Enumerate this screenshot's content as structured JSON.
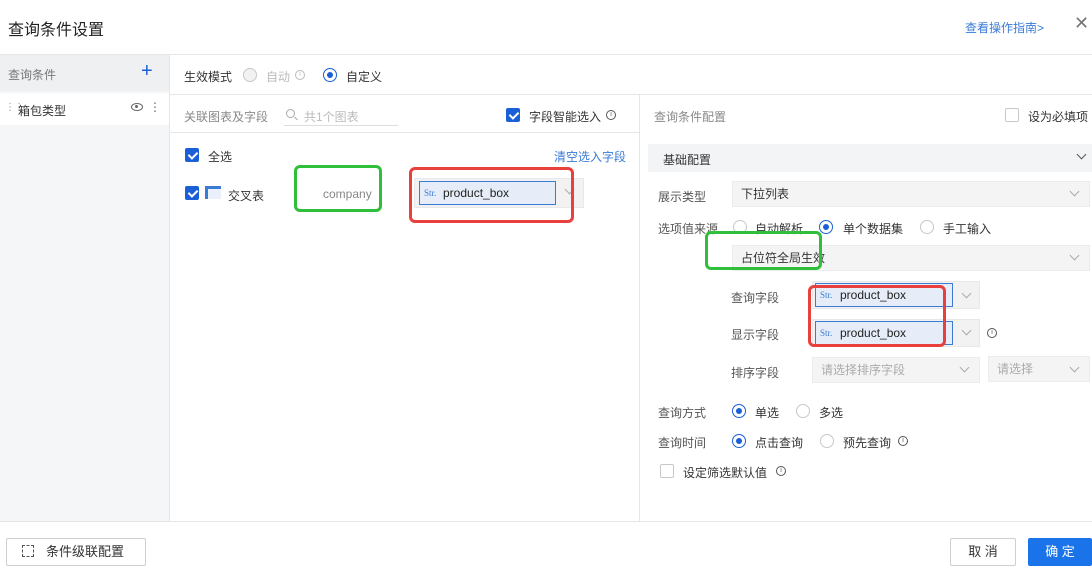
{
  "dialog": {
    "title": "查询条件设置",
    "guide_link": "查看操作指南>",
    "close_icon": "close-icon"
  },
  "left_panel": {
    "title": "查询条件",
    "add_icon": "plus-icon",
    "items": [
      {
        "label": "箱包类型",
        "icons": [
          "drag-handle-icon",
          "eye-icon",
          "more-vertical-icon"
        ]
      }
    ]
  },
  "mode": {
    "label": "生效模式",
    "options": [
      {
        "label": "自动",
        "selected": false,
        "disabled": true
      },
      {
        "label": "自定义",
        "selected": true,
        "disabled": false
      }
    ]
  },
  "related": {
    "label": "关联图表及字段",
    "search_placeholder": "共1个图表",
    "smart_select_label": "字段智能选入",
    "smart_select_checked": true,
    "select_all_label": "全选",
    "clear_link": "清空选入字段",
    "rows": [
      {
        "table_name": "交叉表",
        "source_field": "company",
        "field_type": "Str.",
        "field_name": "product_box",
        "checked": true
      }
    ]
  },
  "config": {
    "title": "查询条件配置",
    "required_label": "设为必填项",
    "section_title": "基础配置",
    "display_type_label": "展示类型",
    "display_type_value": "下拉列表",
    "source_label": "选项值来源",
    "source_options": [
      {
        "label": "自动解析",
        "selected": false
      },
      {
        "label": "单个数据集",
        "selected": true
      },
      {
        "label": "手工输入",
        "selected": false
      }
    ],
    "dataset_value": "占位符全局生效",
    "query_field_label": "查询字段",
    "query_field": {
      "type": "Str.",
      "name": "product_box"
    },
    "display_field_label": "显示字段",
    "display_field": {
      "type": "Str.",
      "name": "product_box"
    },
    "sort_field_label": "排序字段",
    "sort_field_placeholder": "请选择排序字段",
    "sort_order_placeholder": "请选择",
    "query_mode_label": "查询方式",
    "query_mode_options": [
      {
        "label": "单选",
        "selected": true
      },
      {
        "label": "多选",
        "selected": false
      }
    ],
    "query_time_label": "查询时间",
    "query_time_options": [
      {
        "label": "点击查询",
        "selected": true
      },
      {
        "label": "预先查询",
        "selected": false
      }
    ],
    "default_value_label": "设定筛选默认值"
  },
  "footer": {
    "cascade_button": "条件级联配置",
    "cancel_button": "取 消",
    "confirm_button": "确 定"
  },
  "colors": {
    "primary": "#1a73e8",
    "link": "#3a7bd5",
    "highlight_green": "#2fbf3a",
    "highlight_red": "#e8403d"
  }
}
